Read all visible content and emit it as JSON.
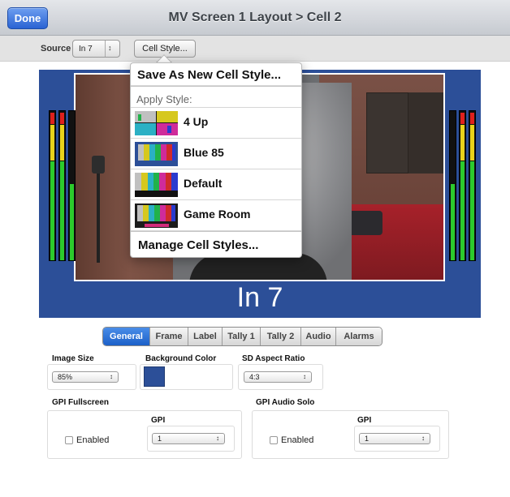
{
  "header": {
    "done_label": "Done",
    "title": "MV Screen 1 Layout > Cell 2"
  },
  "toolbar": {
    "source_label": "Source",
    "source_value": "In 7",
    "source_arrow": "↕",
    "cell_style_label": "Cell Style..."
  },
  "preview": {
    "cell_label": "In 7",
    "border_color": "#2c4f98"
  },
  "popover": {
    "save_label": "Save As New Cell Style...",
    "apply_label": "Apply Style:",
    "styles": [
      {
        "name": "4 Up"
      },
      {
        "name": "Blue 85"
      },
      {
        "name": "Default"
      },
      {
        "name": "Game Room"
      }
    ],
    "manage_label": "Manage Cell Styles..."
  },
  "tabs": [
    {
      "label": "General",
      "active": true
    },
    {
      "label": "Frame"
    },
    {
      "label": "Label"
    },
    {
      "label": "Tally 1"
    },
    {
      "label": "Tally 2"
    },
    {
      "label": "Audio"
    },
    {
      "label": "Alarms"
    }
  ],
  "general": {
    "image_size": {
      "label": "Image Size",
      "value": "85%"
    },
    "background_color": {
      "label": "Background Color",
      "value": "#2c4f98"
    },
    "sd_aspect": {
      "label": "SD Aspect Ratio",
      "value": "4:3"
    },
    "gpi_fullscreen": {
      "label": "GPI Fullscreen",
      "enabled_label": "Enabled",
      "gpi_label": "GPI",
      "gpi_value": "1"
    },
    "gpi_audio_solo": {
      "label": "GPI Audio Solo",
      "enabled_label": "Enabled",
      "gpi_label": "GPI",
      "gpi_value": "1"
    }
  }
}
